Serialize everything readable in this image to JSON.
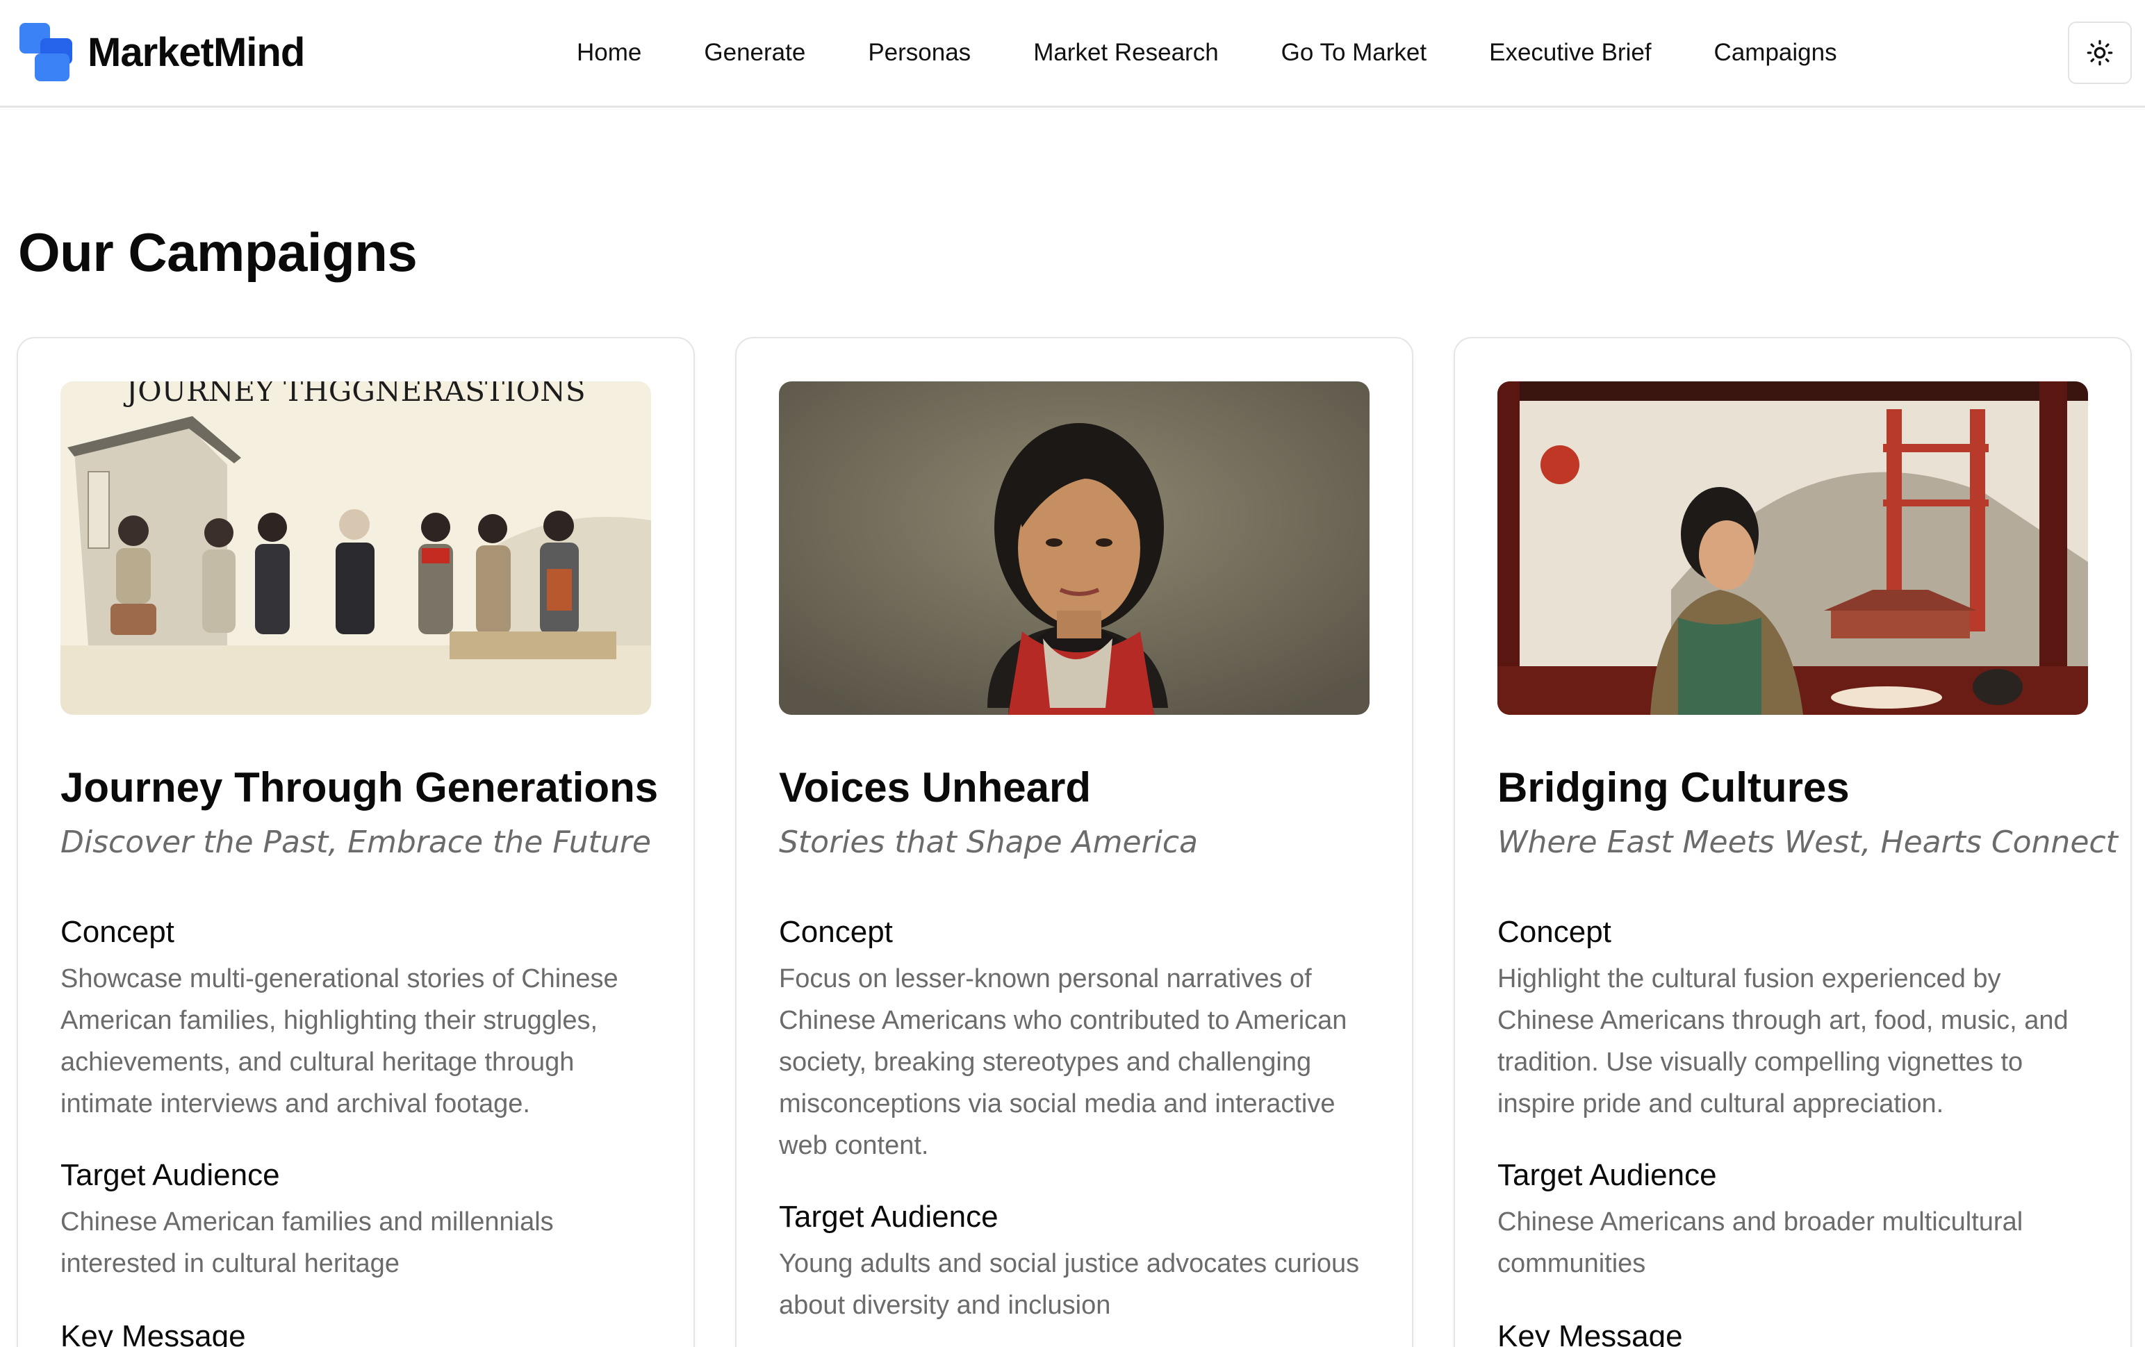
{
  "brand": {
    "name": "MarketMind"
  },
  "nav": {
    "items": [
      "Home",
      "Generate",
      "Personas",
      "Market Research",
      "Go To Market",
      "Executive Brief",
      "Campaigns"
    ]
  },
  "theme_toggle": {
    "icon": "sun-icon"
  },
  "page": {
    "title": "Our Campaigns"
  },
  "campaigns": [
    {
      "image_caption": "JOURNEY THGGNERASTIONS",
      "title": "Journey Through Generations",
      "tagline": "Discover the Past, Embrace the Future",
      "concept_label": "Concept",
      "concept": "Showcase multi-generational stories of Chinese American families, highlighting their struggles, achievements, and cultural heritage through intimate interviews and archival footage.",
      "audience_label": "Target Audience",
      "audience": "Chinese American families and millennials interested in cultural heritage",
      "message_label": "Key Message"
    },
    {
      "title": "Voices Unheard",
      "tagline": "Stories that Shape America",
      "concept_label": "Concept",
      "concept": "Focus on lesser-known personal narratives of Chinese Americans who contributed to American society, breaking stereotypes and challenging misconceptions via social media and interactive web content.",
      "audience_label": "Target Audience",
      "audience": "Young adults and social justice advocates curious about diversity and inclusion"
    },
    {
      "title": "Bridging Cultures",
      "tagline": "Where East Meets West, Hearts Connect",
      "concept_label": "Concept",
      "concept": "Highlight the cultural fusion experienced by Chinese Americans through art, food, music, and tradition. Use visually compelling vignettes to inspire pride and cultural appreciation.",
      "audience_label": "Target Audience",
      "audience": "Chinese Americans and broader multicultural communities",
      "message_label": "Key Message"
    }
  ],
  "colors": {
    "accent": "#3b82f6",
    "muted_text": "#6b6b6b",
    "border": "#e5e5e5"
  }
}
